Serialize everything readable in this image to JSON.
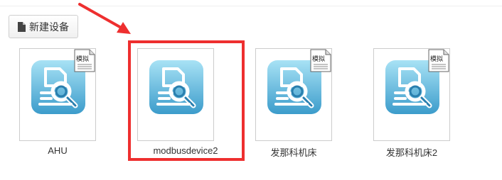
{
  "toolbar": {
    "new_device_label": "新建设备"
  },
  "devices": [
    {
      "name": "AHU",
      "icon": "device-search-icon",
      "simulated": true,
      "badge_text": "模拟"
    },
    {
      "name": "modbusdevice2",
      "icon": "device-search-icon",
      "simulated": false,
      "badge_text": ""
    },
    {
      "name": "发那科机床",
      "icon": "device-search-icon",
      "simulated": true,
      "badge_text": "模拟"
    },
    {
      "name": "发那科机床2",
      "icon": "device-search-icon",
      "simulated": true,
      "badge_text": "模拟"
    }
  ],
  "annotation": {
    "highlight_color": "#ee2f2f",
    "highlighted_device": "modbusdevice2"
  },
  "colors": {
    "icon_blue_top": "#9fdcf2",
    "icon_blue_bottom": "#3f9fcc"
  }
}
